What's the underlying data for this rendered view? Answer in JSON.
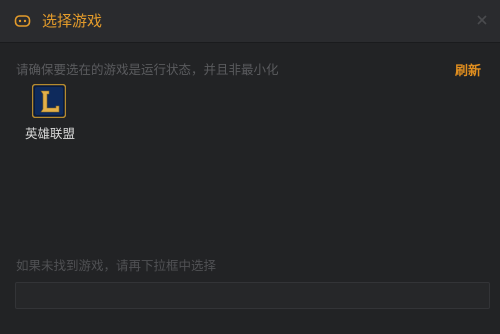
{
  "window": {
    "title": "选择游戏",
    "title_icon": "gamepad-icon",
    "close_icon": "close-icon"
  },
  "main": {
    "hint": "请确保要选在的游戏是运行状态，并且非最小化",
    "refresh_label": "刷新",
    "games": [
      {
        "label": "英雄联盟",
        "icon": "league-of-legends-icon"
      }
    ],
    "not_found_hint": "如果未找到游戏，请再下拉框中选择",
    "dropdown_value": ""
  },
  "colors": {
    "accent": "#e39b2b",
    "background": "#222325",
    "titlebar": "#2a2b2e"
  }
}
